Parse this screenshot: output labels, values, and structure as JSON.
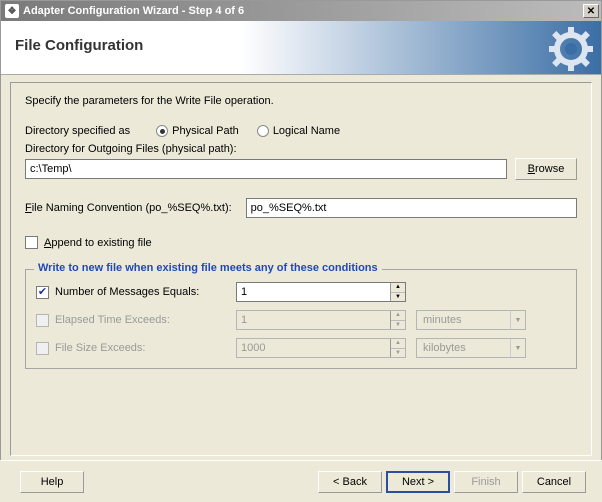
{
  "window": {
    "title": "Adapter Configuration Wizard - Step 4 of 6",
    "close_glyph": "✕"
  },
  "banner": {
    "page_title": "File Configuration"
  },
  "instructions": "Specify the parameters for the Write File operation.",
  "dir_spec_label": "Directory specified as",
  "radios": {
    "physical": {
      "label": "Physical Path",
      "selected": true
    },
    "logical": {
      "label": "Logical Name",
      "selected": false
    }
  },
  "outgoing_label": "Directory for Outgoing Files (physical path):",
  "outgoing_value": "c:\\Temp\\",
  "browse_label": "Browse",
  "naming_label": "File Naming Convention (po_%SEQ%.txt):",
  "naming_value": "po_%SEQ%.txt",
  "append_label": "Append to existing file",
  "group_title": "Write to new file when existing file meets any of these conditions",
  "conditions": {
    "num_msgs": {
      "label": "Number of Messages Equals:",
      "value": "1",
      "checked": true,
      "enabled": true
    },
    "elapsed": {
      "label": "Elapsed Time Exceeds:",
      "value": "1",
      "unit": "minutes",
      "checked": false,
      "enabled": false
    },
    "filesize": {
      "label": "File Size Exceeds:",
      "value": "1000",
      "unit": "kilobytes",
      "checked": false,
      "enabled": false
    }
  },
  "footer": {
    "help": "Help",
    "back": "< Back",
    "next": "Next >",
    "finish": "Finish",
    "cancel": "Cancel"
  }
}
